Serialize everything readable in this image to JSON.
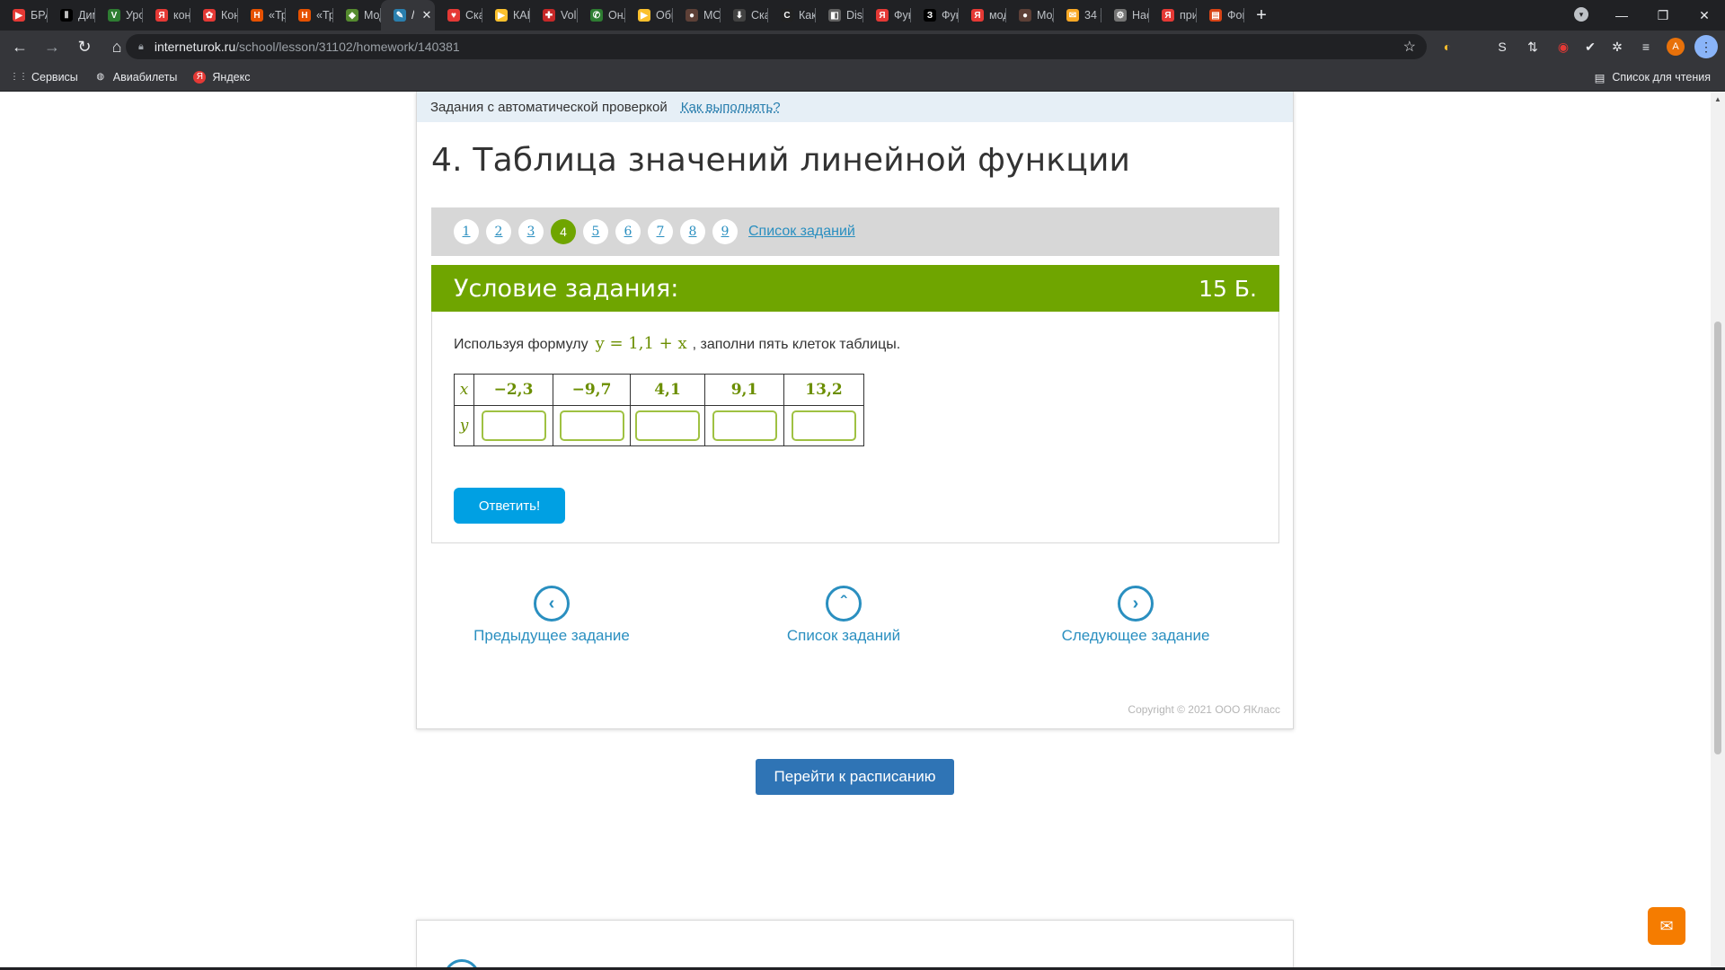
{
  "browser": {
    "tabs": [
      {
        "label": "БРА",
        "fav_color": "#e53935",
        "fav_glyph": "▶"
      },
      {
        "label": "Дим",
        "fav_color": "#000000",
        "fav_glyph": "Ⅱ"
      },
      {
        "label": "Урок",
        "fav_color": "#2e7d32",
        "fav_glyph": "V"
      },
      {
        "label": "конс",
        "fav_color": "#e53935",
        "fav_glyph": "Я"
      },
      {
        "label": "Кон",
        "fav_color": "#e53935",
        "fav_glyph": "✿"
      },
      {
        "label": "«Тр",
        "fav_color": "#e65100",
        "fav_glyph": "H"
      },
      {
        "label": "«Тр",
        "fav_color": "#e65100",
        "fav_glyph": "H"
      },
      {
        "label": "Мод",
        "fav_color": "#558b2f",
        "fav_glyph": "◆"
      },
      {
        "label": "/",
        "fav_color": "#2a7fae",
        "fav_glyph": "✎",
        "active": true
      },
      {
        "label": "Ска",
        "fav_color": "#e53935",
        "fav_glyph": "♥"
      },
      {
        "label": "КАК",
        "fav_color": "#fbc02d",
        "fav_glyph": "▶"
      },
      {
        "label": "Volk",
        "fav_color": "#c62828",
        "fav_glyph": "✚"
      },
      {
        "label": "Онл",
        "fav_color": "#2e7d32",
        "fav_glyph": "✆"
      },
      {
        "label": "Обн",
        "fav_color": "#fbc02d",
        "fav_glyph": "▶"
      },
      {
        "label": "МО,",
        "fav_color": "#5d4037",
        "fav_glyph": "●"
      },
      {
        "label": "Ска",
        "fav_color": "#424242",
        "fav_glyph": "⬇"
      },
      {
        "label": "Как",
        "fav_color": "#212121",
        "fav_glyph": "C"
      },
      {
        "label": "Disc",
        "fav_color": "#616161",
        "fav_glyph": "◧"
      },
      {
        "label": "Фун",
        "fav_color": "#e53935",
        "fav_glyph": "Я"
      },
      {
        "label": "Фун",
        "fav_color": "#000000",
        "fav_glyph": "З"
      },
      {
        "label": "мод",
        "fav_color": "#e53935",
        "fav_glyph": "Я"
      },
      {
        "label": "Мод",
        "fav_color": "#5d4037",
        "fav_glyph": "●"
      },
      {
        "label": "34 -",
        "fav_color": "#f9a825",
        "fav_glyph": "✉"
      },
      {
        "label": "Нас",
        "fav_color": "#757575",
        "fav_glyph": "⚙"
      },
      {
        "label": "при",
        "fav_color": "#e53935",
        "fav_glyph": "Я"
      },
      {
        "label": "Фон",
        "fav_color": "#d84315",
        "fav_glyph": "▤"
      }
    ],
    "tab_close_glyph": "✕",
    "new_tab_glyph": "+",
    "window_controls": {
      "minimize": "—",
      "restore": "❐",
      "close": "✕"
    },
    "address": {
      "host": "interneturok.ru",
      "path": "/school/lesson/31102/homework/140381"
    },
    "avatar_letter": "A",
    "bookmarks": [
      {
        "label": "Сервисы",
        "icon": "apps-grid-icon",
        "glyph": "⋮⋮"
      },
      {
        "label": "Авиабилеты",
        "icon": "globe-icon",
        "glyph": "◍"
      },
      {
        "label": "Яндекс",
        "icon": "yandex-icon",
        "glyph": "Я"
      }
    ],
    "reading_list": "Список для чтения"
  },
  "page": {
    "auto_check_text": "Задания с автоматической проверкой",
    "how_to_link": "Как выполнять?",
    "lesson_title": "4. Таблица значений линейной функции",
    "pager": {
      "pages": [
        "1",
        "2",
        "3",
        "4",
        "5",
        "6",
        "7",
        "8",
        "9"
      ],
      "current": "4",
      "list_link": "Список заданий"
    },
    "task": {
      "heading": "Условие задания:",
      "points": "15 Б.",
      "text_before": "Используя формулу",
      "formula": "y = 1,1 + x",
      "text_after": ", заполни пять клеток таблицы.",
      "table": {
        "x_label": "x",
        "y_label": "y",
        "x_values": [
          "−2,3",
          "−9,7",
          "4,1",
          "9,1",
          "13,2"
        ],
        "y_values": [
          "",
          "",
          "",
          "",
          ""
        ]
      },
      "answer_button": "Ответить!"
    },
    "navigation": {
      "prev": "Предыдущее задание",
      "list": "Список заданий",
      "next": "Следующее задание"
    },
    "copyright": "Copyright © 2021 ООО ЯКласс",
    "schedule_button": "Перейти к расписанию"
  },
  "colors": {
    "accent_green": "#6fa500",
    "link_blue": "#2a8fc0",
    "answer_button": "#00a0e3",
    "schedule_button": "#2f74b5",
    "chat_button": "#f57c00"
  }
}
